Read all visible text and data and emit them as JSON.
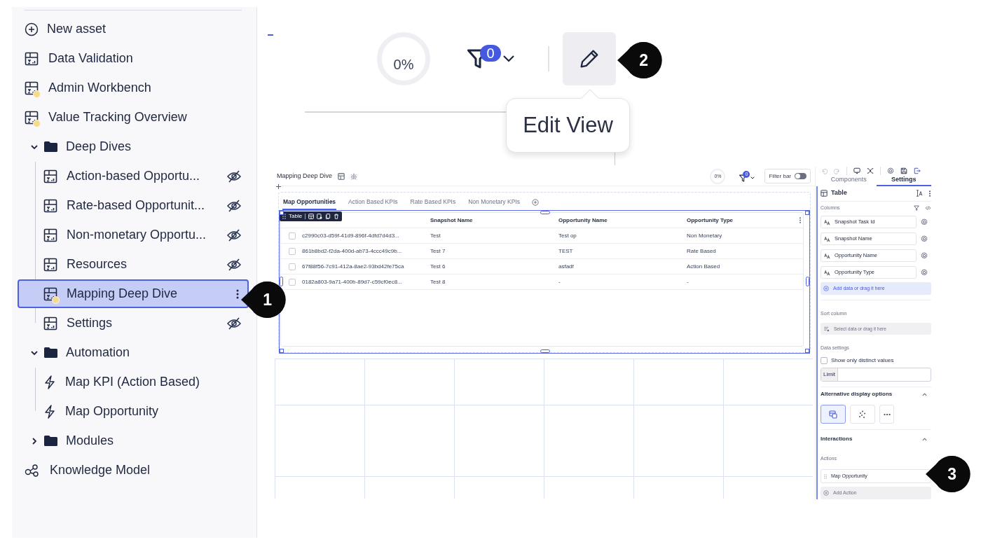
{
  "sidebar": {
    "items": [
      {
        "kind": "action",
        "label": "New asset",
        "selected": false
      },
      {
        "kind": "view",
        "label": "Data Validation",
        "draft": false,
        "selected": false
      },
      {
        "kind": "view",
        "label": "Admin Workbench",
        "draft": true,
        "selected": false
      },
      {
        "kind": "view",
        "label": "Value Tracking Overview",
        "draft": true,
        "selected": false
      },
      {
        "kind": "folder",
        "label": "Deep Dives",
        "expanded": true,
        "selected": false,
        "children": [
          {
            "kind": "view",
            "label": "Action-based Opportu...",
            "draft": false,
            "hidden": true,
            "selected": false
          },
          {
            "kind": "view",
            "label": "Rate-based Opportunit...",
            "draft": false,
            "hidden": true,
            "selected": false
          },
          {
            "kind": "view",
            "label": "Non-monetary Opportu...",
            "draft": false,
            "hidden": true,
            "selected": false
          },
          {
            "kind": "view",
            "label": "Resources",
            "draft": false,
            "hidden": true,
            "selected": false
          },
          {
            "kind": "view",
            "label": "Mapping Deep Dive",
            "draft": true,
            "hidden": false,
            "selected": true
          },
          {
            "kind": "view",
            "label": "Settings",
            "draft": false,
            "hidden": true,
            "selected": false
          }
        ]
      },
      {
        "kind": "folder",
        "label": "Automation",
        "expanded": true,
        "selected": false,
        "children": [
          {
            "kind": "automation",
            "label": "Map KPI (Action Based)",
            "selected": false
          },
          {
            "kind": "automation",
            "label": "Map Opportunity",
            "selected": false
          }
        ]
      },
      {
        "kind": "folder",
        "label": "Modules",
        "expanded": false,
        "selected": false
      },
      {
        "kind": "knowledge",
        "label": "Knowledge Model",
        "selected": false
      }
    ]
  },
  "zoomed_toolbar": {
    "progress": "0%",
    "filter_count": "0",
    "tooltip": "Edit View"
  },
  "app": {
    "title": "Mapping Deep Dive",
    "progress": "0%",
    "filter_count": "0",
    "filter_bar": {
      "label": "Filter bar",
      "on": false
    },
    "tabs": [
      {
        "label": "Map Opportunities",
        "selected": true
      },
      {
        "label": "Action Based KPIs",
        "selected": false
      },
      {
        "label": "Rate Based KPIs",
        "selected": false
      },
      {
        "label": "Non Monetary KPIs",
        "selected": false
      }
    ],
    "table": {
      "toolbar_label": "Table",
      "columns": [
        "",
        "Snapshot Name",
        "Opportunity Name",
        "Opportunity Type"
      ],
      "rows": [
        {
          "checked": false,
          "cells": [
            "c2990c03-d59f-41d9-896f-4dfd7d4d3...",
            "Test",
            "Test op",
            "Non Monetary"
          ]
        },
        {
          "checked": false,
          "cells": [
            "861b8bd2-f2da-400d-ab73-4ccc49c9b...",
            "Test 7",
            "TEST",
            "Rate Based"
          ]
        },
        {
          "checked": false,
          "cells": [
            "67f88f56-7c91-412a-8ae2-93bd42fe75ca",
            "Test 6",
            "asfadf",
            "Action Based"
          ]
        },
        {
          "checked": false,
          "cells": [
            "0182a803-9a71-400b-89d7-c59cf0ec8...",
            "Test 8",
            "-",
            "-"
          ]
        }
      ]
    }
  },
  "settings_panel": {
    "tabs": [
      {
        "label": "Components",
        "selected": false
      },
      {
        "label": "Settings",
        "selected": true
      }
    ],
    "widget": "Table",
    "columns_label": "Columns",
    "column_fields": [
      "Snapshot Task Id",
      "Snapshot Name",
      "Opportunity Name",
      "Opportunity Type"
    ],
    "add_data": "Add data or drag it here",
    "sort_label": "Sort column",
    "sort_drop": "Select data or drag it here",
    "data_settings_label": "Data settings",
    "distinct": {
      "label": "Show only distinct values",
      "checked": false
    },
    "limit_label": "Limit",
    "display_title": "Alternative display options",
    "display_options": [
      {
        "kind": "table",
        "selected": true
      },
      {
        "kind": "scatter",
        "selected": false
      },
      {
        "kind": "more",
        "selected": false
      }
    ],
    "interactions_title": "Interactions",
    "actions_label": "Actions",
    "actions": [
      "Map Opportunity"
    ],
    "add_action": "Add Action"
  },
  "callouts": [
    "1",
    "2",
    "3"
  ]
}
